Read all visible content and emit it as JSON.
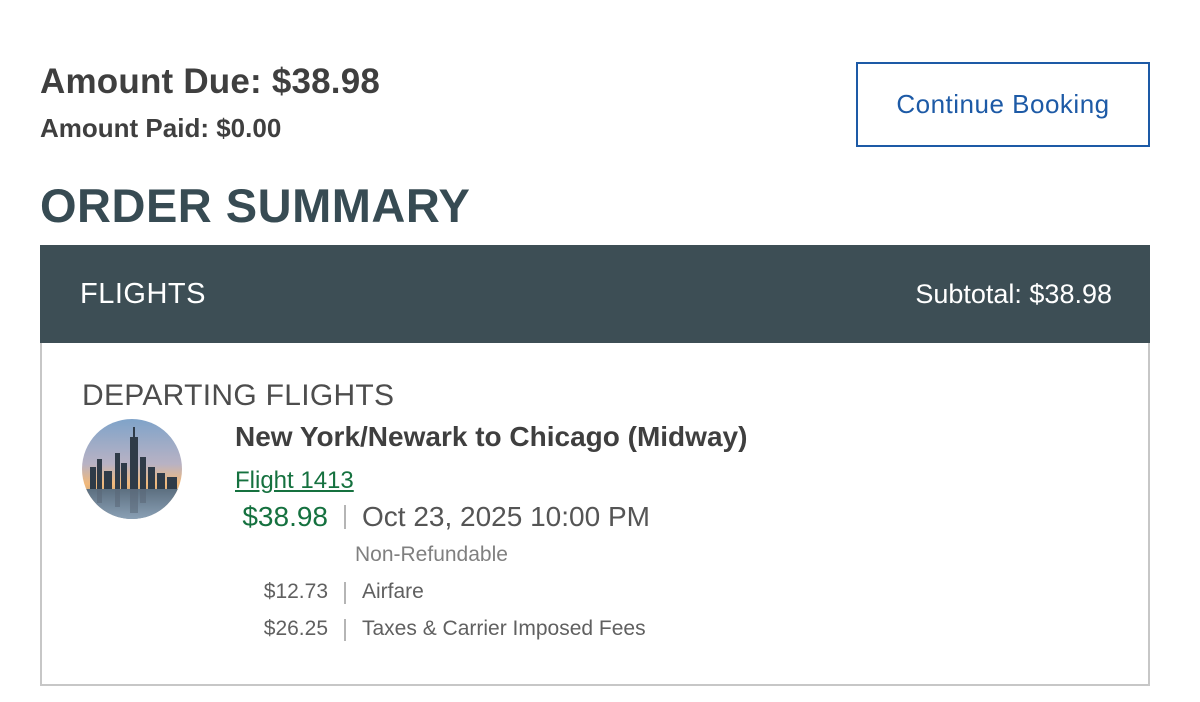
{
  "summary": {
    "amount_due": "Amount Due: $38.98",
    "amount_paid": "Amount Paid: $0.00",
    "continue_label": "Continue Booking",
    "order_title": "ORDER SUMMARY"
  },
  "flights": {
    "header_label": "FLIGHTS",
    "subtotal": "Subtotal: $38.98",
    "section_label": "DEPARTING FLIGHTS",
    "route": "New York/Newark to Chicago (Midway)",
    "flight_link": "Flight 1413",
    "price": "$38.98",
    "datetime": "Oct 23, 2025 10:00 PM",
    "refund_policy": "Non-Refundable",
    "fees": [
      {
        "amount": "$12.73",
        "label": "Airfare"
      },
      {
        "amount": "$26.25",
        "label": "Taxes & Carrier Imposed Fees"
      }
    ],
    "thumbnail_icon": "city-skyline-photo"
  },
  "colors": {
    "brand_dark": "#3d4e55",
    "link_blue": "#1d5aa6",
    "price_green": "#15713f"
  }
}
